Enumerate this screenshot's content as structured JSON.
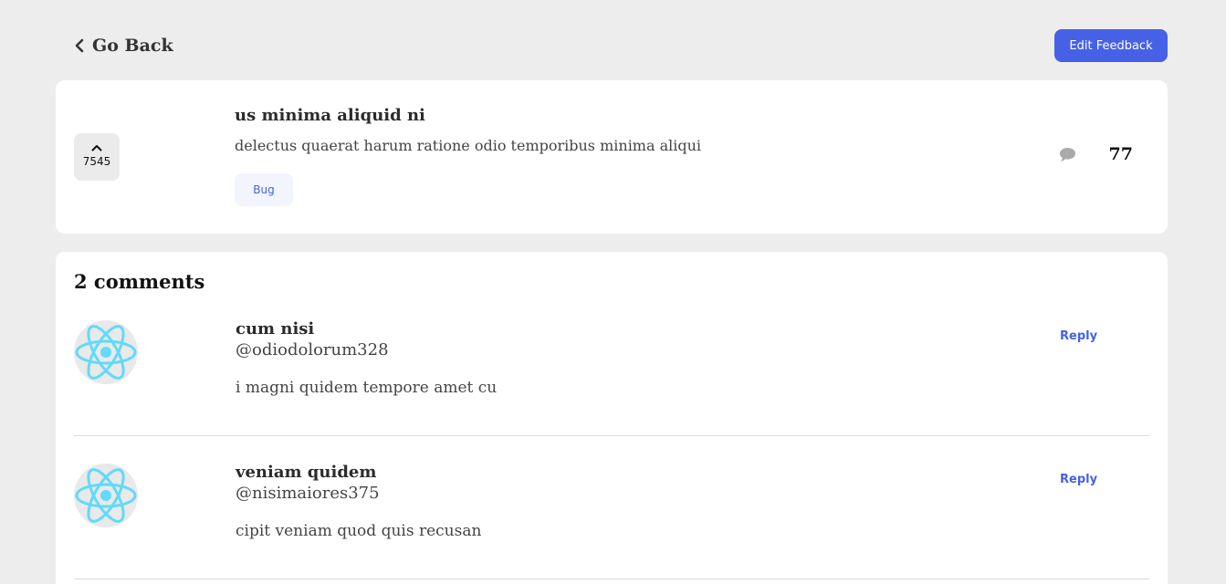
{
  "header": {
    "back_label": "Go Back",
    "edit_label": "Edit Feedback"
  },
  "colors": {
    "accent": "#4661e6",
    "tag_bg": "#f2f4ff",
    "background": "#ededed",
    "react_logo": "#61dafb"
  },
  "icons": {
    "back": "chevron-left-icon",
    "upvote": "chevron-up-icon",
    "comments": "speech-bubble-icon",
    "avatar": "react-logo-icon"
  },
  "feedback": {
    "title": "us minima aliquid ni",
    "description": "delectus quaerat harum ratione odio temporibus minima aliqui",
    "category": "Bug",
    "upvotes": "7545",
    "comment_count": "77"
  },
  "comments_section": {
    "heading": "2 comments",
    "reply_label": "Reply",
    "items": [
      {
        "name": "cum nisi",
        "username": "@odiodolorum328",
        "content": "i magni quidem tempore amet cu"
      },
      {
        "name": "veniam quidem",
        "username": "@nisimaiores375",
        "content": "cipit veniam quod quis recusan"
      }
    ]
  }
}
